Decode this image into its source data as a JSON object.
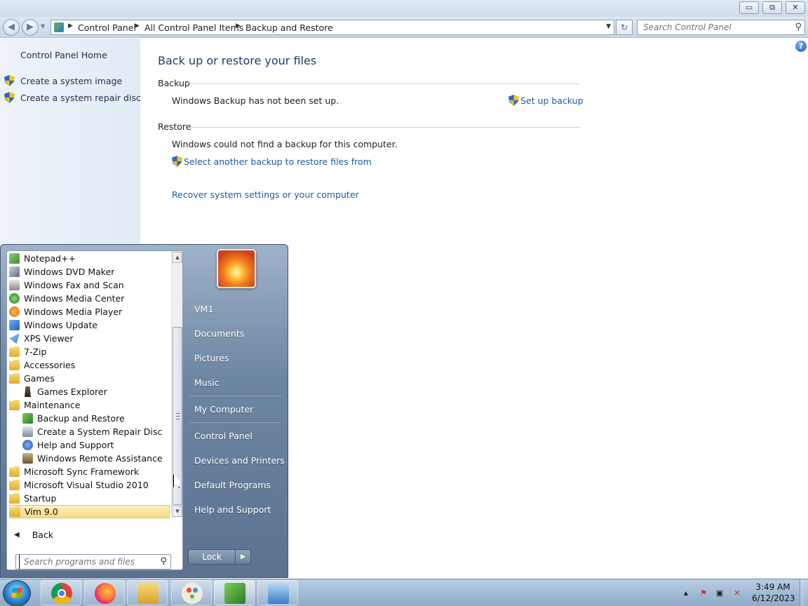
{
  "window": {
    "caption_buttons": [
      "▭",
      "⧉",
      "✕"
    ]
  },
  "address_bar": {
    "back_glyph": "◀",
    "forward_glyph": "▶",
    "breadcrumbs": [
      "Control Panel",
      "All Control Panel Items",
      "Backup and Restore"
    ],
    "search_placeholder": "Search Control Panel",
    "refresh_glyph": "↻"
  },
  "sidebar": {
    "home_label": "Control Panel Home",
    "links": [
      "Create a system image",
      "Create a system repair disc"
    ]
  },
  "main": {
    "heading": "Back up or restore your files",
    "help_glyph": "?",
    "backup": {
      "section_title": "Backup",
      "status": "Windows Backup has not been set up.",
      "action_link": "Set up backup"
    },
    "restore": {
      "section_title": "Restore",
      "status": "Windows could not find a backup for this computer.",
      "select_link": "Select another backup to restore files from",
      "recover_link": "Recover system settings or your computer"
    }
  },
  "start_menu": {
    "programs": [
      {
        "label": "Notepad++",
        "icon": "notepad-plus-plus-icon",
        "indent": 0
      },
      {
        "label": "Windows DVD Maker",
        "icon": "dvd-maker-icon",
        "indent": 0
      },
      {
        "label": "Windows Fax and Scan",
        "icon": "fax-scan-icon",
        "indent": 0
      },
      {
        "label": "Windows Media Center",
        "icon": "media-center-icon",
        "indent": 0
      },
      {
        "label": "Windows Media Player",
        "icon": "media-player-icon",
        "indent": 0
      },
      {
        "label": "Windows Update",
        "icon": "windows-update-icon",
        "indent": 0
      },
      {
        "label": "XPS Viewer",
        "icon": "xps-viewer-icon",
        "indent": 0
      },
      {
        "label": "7-Zip",
        "icon": "folder-icon",
        "indent": 0
      },
      {
        "label": "Accessories",
        "icon": "folder-icon",
        "indent": 0
      },
      {
        "label": "Games",
        "icon": "folder-icon",
        "indent": 0
      },
      {
        "label": "Games Explorer",
        "icon": "games-explorer-icon",
        "indent": 1
      },
      {
        "label": "Maintenance",
        "icon": "folder-icon",
        "indent": 0
      },
      {
        "label": "Backup and Restore",
        "icon": "backup-restore-icon",
        "indent": 1
      },
      {
        "label": "Create a System Repair Disc",
        "icon": "repair-disc-icon",
        "indent": 1
      },
      {
        "label": "Help and Support",
        "icon": "help-icon",
        "indent": 1
      },
      {
        "label": "Windows Remote Assistance",
        "icon": "remote-assistance-icon",
        "indent": 1
      },
      {
        "label": "Microsoft Sync Framework",
        "icon": "folder-icon",
        "indent": 0
      },
      {
        "label": "Microsoft Visual Studio 2010",
        "icon": "folder-icon",
        "indent": 0
      },
      {
        "label": "Startup",
        "icon": "folder-icon",
        "indent": 0
      },
      {
        "label": "Vim 9.0",
        "icon": "folder-icon",
        "indent": 0,
        "selected": true
      }
    ],
    "back_label": "Back",
    "search_placeholder": "Search programs and files",
    "right_items": [
      "VM1",
      "Documents",
      "Pictures",
      "Music",
      "My Computer",
      "Control Panel",
      "Devices and Printers",
      "Default Programs",
      "Help and Support"
    ],
    "lock_label": "Lock",
    "lock_arrow_glyph": "▶"
  },
  "taskbar": {
    "pinned": [
      "chrome-icon",
      "firefox-icon",
      "explorer-icon",
      "paint-icon",
      "backup-restore-icon",
      "control-panel-icon"
    ],
    "time": "3:49 AM",
    "date": "6/12/2023",
    "tray_glyphs": [
      "▲",
      "⚑",
      "▣",
      "✕"
    ]
  },
  "colors": {
    "link": "#1c5aa7",
    "heading": "#1e3d6e",
    "start_menu_right": "#6d86a2",
    "selected_item": "#f6d980"
  }
}
